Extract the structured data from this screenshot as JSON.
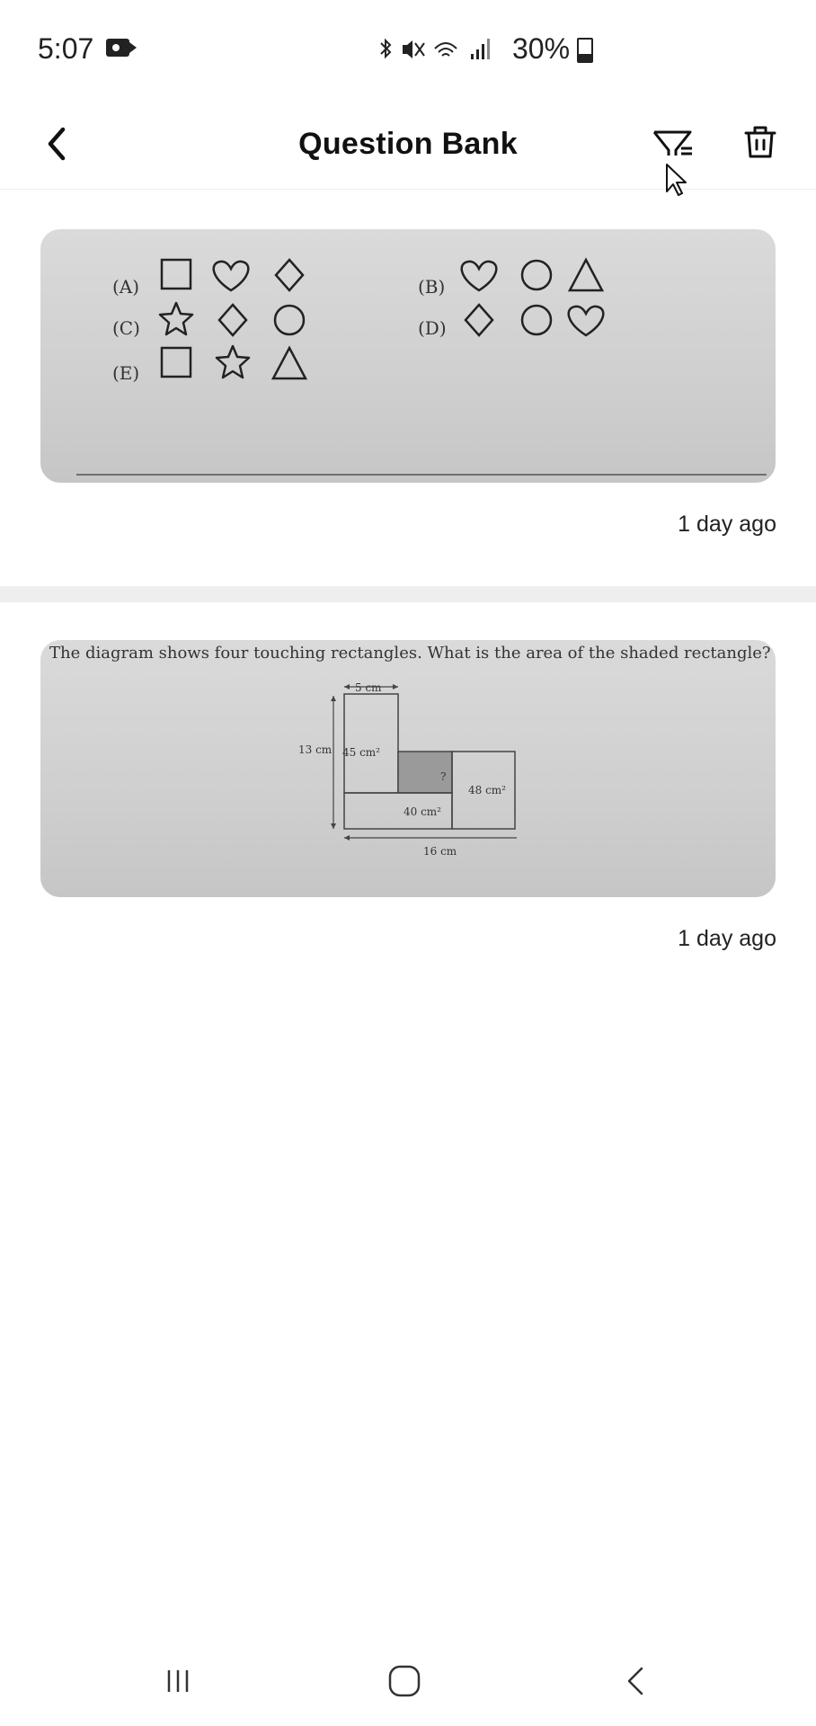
{
  "status_bar": {
    "time": "5:07",
    "battery": "30%",
    "icons": [
      "camera-record-icon",
      "bluetooth-icon",
      "mute-icon",
      "wifi-icon",
      "signal-icon",
      "battery-icon"
    ]
  },
  "app_bar": {
    "title": "Question Bank",
    "back_icon": "chevron-left-icon",
    "filter_icon": "filter-icon",
    "delete_icon": "trash-icon"
  },
  "questions": [
    {
      "options": [
        {
          "label": "(A)",
          "shapes": [
            "square",
            "heart",
            "diamond"
          ]
        },
        {
          "label": "(B)",
          "shapes": [
            "heart",
            "circle",
            "triangle"
          ]
        },
        {
          "label": "(C)",
          "shapes": [
            "star",
            "diamond",
            "circle"
          ]
        },
        {
          "label": "(D)",
          "shapes": [
            "diamond",
            "circle",
            "heart"
          ]
        },
        {
          "label": "(E)",
          "shapes": [
            "square",
            "star",
            "triangle"
          ]
        }
      ],
      "time_ago": "1 day ago"
    },
    {
      "text": "The diagram shows four touching rectangles. What is the area of the shaded rectangle?",
      "diagram": {
        "top_width": "5 cm",
        "left_height": "13 cm",
        "bottom_width": "16 cm",
        "area_top": "45 cm²",
        "area_shaded": "?",
        "area_bottom": "40 cm²",
        "area_right": "48 cm²"
      },
      "time_ago": "1 day ago"
    }
  ],
  "nav_bar": {
    "recents_icon": "recents-icon",
    "home_icon": "home-icon",
    "back_icon": "back-icon"
  }
}
